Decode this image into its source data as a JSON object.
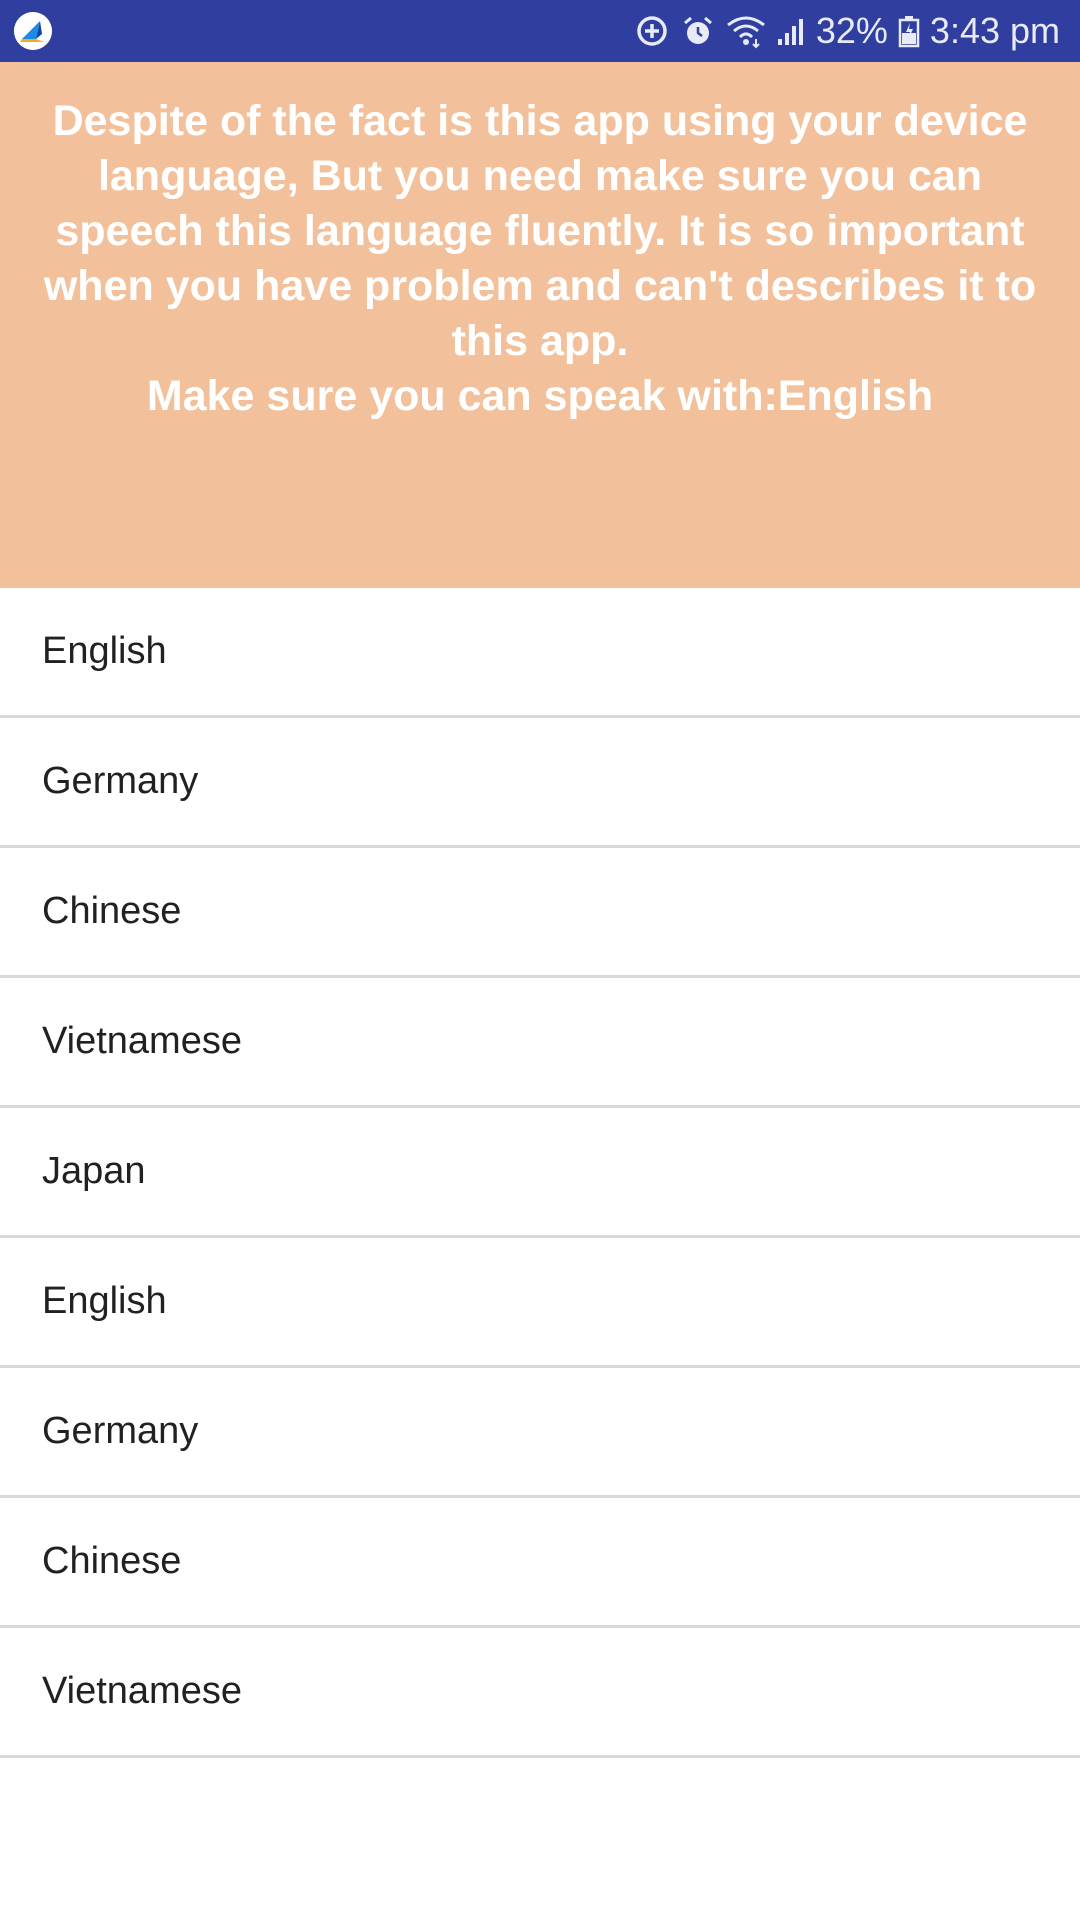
{
  "status_bar": {
    "icons": [
      "app-logo-icon",
      "data-saver-icon",
      "alarm-icon",
      "wifi-icon",
      "signal-icon",
      "battery-icon"
    ],
    "battery_percent": "32%",
    "time": "3:43 pm",
    "background_color": "#303f9f"
  },
  "notice": {
    "line1": "Despite of the fact is this app using your device language, But you need make sure you can speech this language fluently. It is so important when you have problem and can't describes it to this app.",
    "line2": "Make sure you can speak with:English",
    "background_color": "#f2c19b"
  },
  "languages": [
    {
      "label": "English"
    },
    {
      "label": "Germany"
    },
    {
      "label": "Chinese"
    },
    {
      "label": "Vietnamese"
    },
    {
      "label": "Japan"
    },
    {
      "label": "English"
    },
    {
      "label": "Germany"
    },
    {
      "label": "Chinese"
    },
    {
      "label": "Vietnamese"
    }
  ]
}
